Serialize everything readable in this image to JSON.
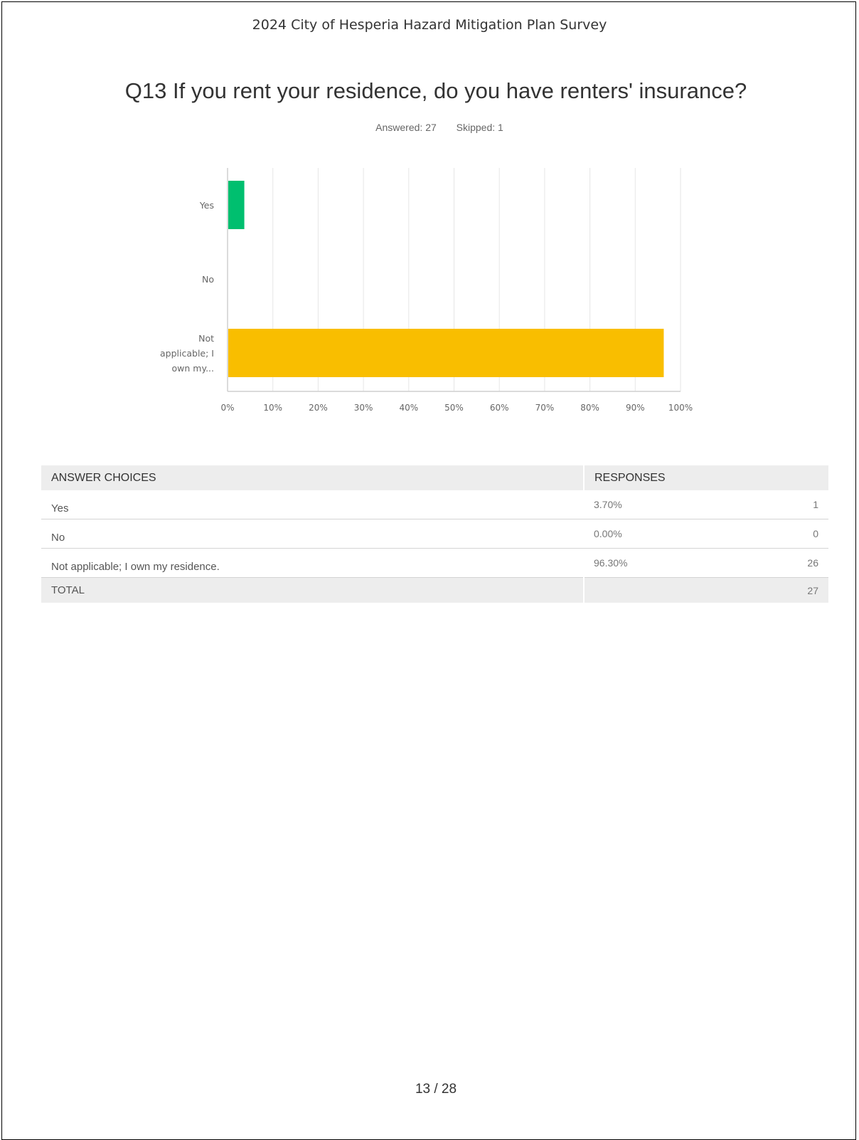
{
  "survey_title": "2024 City of Hesperia Hazard Mitigation Plan Survey",
  "question": "Q13 If you rent your residence, do you have renters' insurance?",
  "stats": {
    "answered": "Answered: 27",
    "skipped": "Skipped: 1"
  },
  "chart_data": {
    "type": "bar",
    "orientation": "horizontal",
    "categories": [
      [
        "Yes"
      ],
      [
        "No"
      ],
      [
        "Not",
        "applicable; I",
        "own my..."
      ]
    ],
    "values": [
      3.7,
      0.0,
      96.3
    ],
    "colors": [
      "#00bf6f",
      "#ffffff",
      "#f9be00"
    ],
    "xlim": [
      0,
      100
    ],
    "xticks": [
      "0%",
      "10%",
      "20%",
      "30%",
      "40%",
      "50%",
      "60%",
      "70%",
      "80%",
      "90%",
      "100%"
    ],
    "grid": true
  },
  "table": {
    "headers": {
      "choice": "ANSWER CHOICES",
      "responses": "RESPONSES"
    },
    "rows": [
      {
        "choice": "Yes",
        "percent": "3.70%",
        "count": "1"
      },
      {
        "choice": "No",
        "percent": "0.00%",
        "count": "0"
      },
      {
        "choice": "Not applicable; I own my residence.",
        "percent": "96.30%",
        "count": "26"
      }
    ],
    "total": {
      "label": "TOTAL",
      "count": "27"
    }
  },
  "page_number": "13 / 28"
}
